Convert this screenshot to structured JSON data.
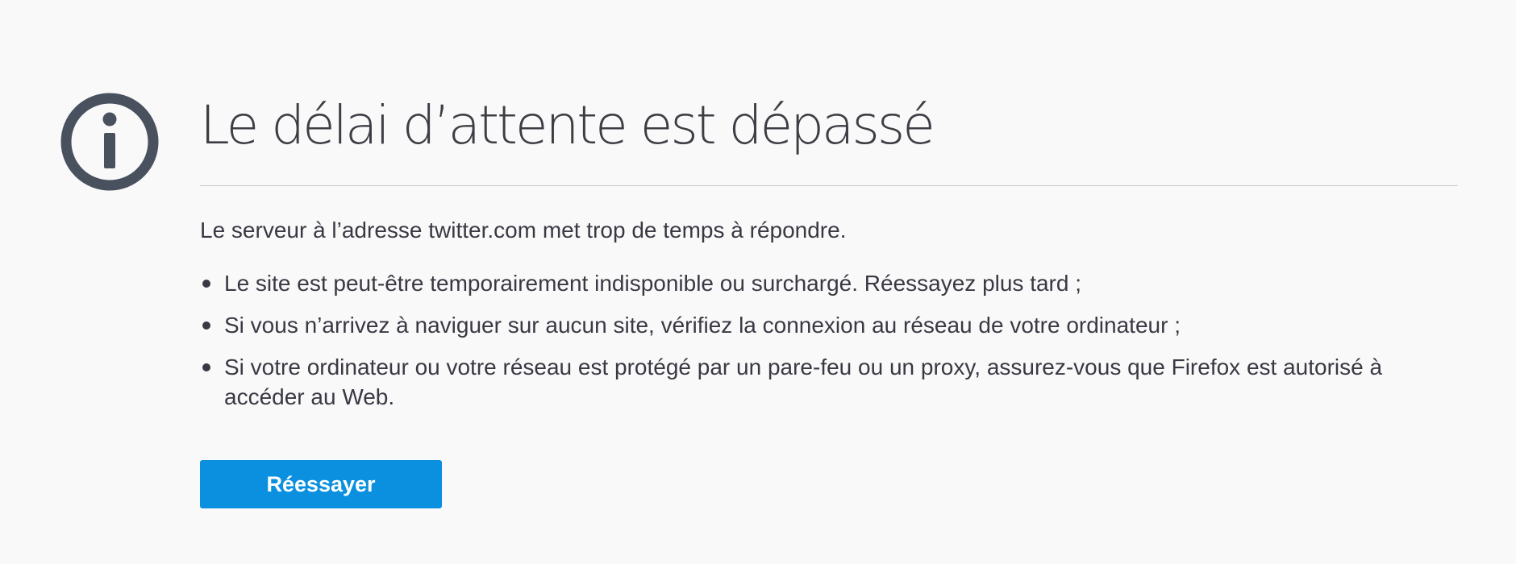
{
  "error": {
    "icon": "info-icon",
    "title": "Le délai d’attente est dépassé",
    "description": "Le serveur à l’adresse twitter.com met trop de temps à répondre.",
    "suggestions": [
      "Le site est peut-être temporairement indisponible ou surchargé. Réessayez plus tard ;",
      "Si vous n’arrivez à naviguer sur aucun site, vérifiez la connexion au réseau de votre ordinateur ;",
      "Si votre ordinateur ou votre réseau est protégé par un pare-feu ou un proxy, assurez-vous que Firefox est autorisé à accéder au Web."
    ],
    "retry_label": "Réessayer"
  },
  "colors": {
    "background": "#f9f9fa",
    "icon": "#48515d",
    "text": "#393943",
    "accent": "#0a90df"
  }
}
